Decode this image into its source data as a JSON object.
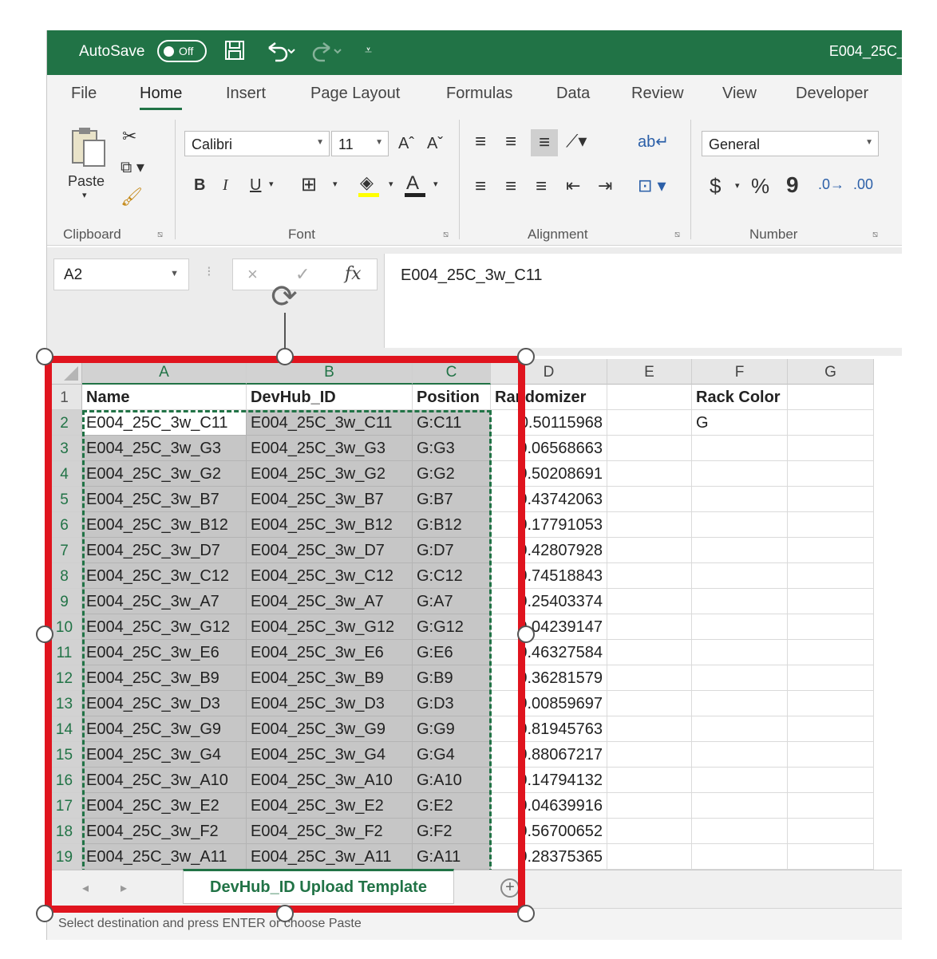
{
  "titlebar": {
    "autosave_label": "AutoSave",
    "autosave_state": "Off",
    "doc_title": "E004_25C_",
    "save_icon": "floppy-disk-icon",
    "undo_icon": "undo-icon",
    "redo_icon": "redo-icon"
  },
  "tabs": [
    "File",
    "Home",
    "Insert",
    "Page Layout",
    "Formulas",
    "Data",
    "Review",
    "View",
    "Developer"
  ],
  "active_tab": "Home",
  "ribbon": {
    "clipboard": {
      "paste_label": "Paste",
      "group_label": "Clipboard"
    },
    "font": {
      "font_name": "Calibri",
      "font_size": "11",
      "group_label": "Font",
      "bold": "B",
      "italic": "I",
      "underline": "U"
    },
    "alignment": {
      "group_label": "Alignment"
    },
    "number": {
      "format": "General",
      "currency": "$",
      "percent": "%",
      "comma": "9",
      "group_label": "Number"
    }
  },
  "formula_bar": {
    "name_box": "A2",
    "cancel_icon": "×",
    "enter_icon": "✓",
    "fx_label": "fx",
    "formula": "E004_25C_3w_C11"
  },
  "columns": [
    "A",
    "B",
    "C",
    "D",
    "E",
    "F",
    "G"
  ],
  "rows": [
    {
      "n": "1",
      "a": "Name",
      "b": "DevHub_ID",
      "c": "Position",
      "d": "Randomizer",
      "f": "Rack Color"
    },
    {
      "n": "2",
      "a": "E004_25C_3w_C11",
      "b": "E004_25C_3w_C11",
      "c": "G:C11",
      "d": "0.50115968",
      "f": "G"
    },
    {
      "n": "3",
      "a": "E004_25C_3w_G3",
      "b": "E004_25C_3w_G3",
      "c": "G:G3",
      "d": "0.06568663",
      "f": ""
    },
    {
      "n": "4",
      "a": "E004_25C_3w_G2",
      "b": "E004_25C_3w_G2",
      "c": "G:G2",
      "d": "0.50208691",
      "f": ""
    },
    {
      "n": "5",
      "a": "E004_25C_3w_B7",
      "b": "E004_25C_3w_B7",
      "c": "G:B7",
      "d": "0.43742063",
      "f": ""
    },
    {
      "n": "6",
      "a": "E004_25C_3w_B12",
      "b": "E004_25C_3w_B12",
      "c": "G:B12",
      "d": "0.17791053",
      "f": ""
    },
    {
      "n": "7",
      "a": "E004_25C_3w_D7",
      "b": "E004_25C_3w_D7",
      "c": "G:D7",
      "d": "0.42807928",
      "f": ""
    },
    {
      "n": "8",
      "a": "E004_25C_3w_C12",
      "b": "E004_25C_3w_C12",
      "c": "G:C12",
      "d": "0.74518843",
      "f": ""
    },
    {
      "n": "9",
      "a": "E004_25C_3w_A7",
      "b": "E004_25C_3w_A7",
      "c": "G:A7",
      "d": "0.25403374",
      "f": ""
    },
    {
      "n": "10",
      "a": "E004_25C_3w_G12",
      "b": "E004_25C_3w_G12",
      "c": "G:G12",
      "d": "0.04239147",
      "f": ""
    },
    {
      "n": "11",
      "a": "E004_25C_3w_E6",
      "b": "E004_25C_3w_E6",
      "c": "G:E6",
      "d": "0.46327584",
      "f": ""
    },
    {
      "n": "12",
      "a": "E004_25C_3w_B9",
      "b": "E004_25C_3w_B9",
      "c": "G:B9",
      "d": "0.36281579",
      "f": ""
    },
    {
      "n": "13",
      "a": "E004_25C_3w_D3",
      "b": "E004_25C_3w_D3",
      "c": "G:D3",
      "d": "0.00859697",
      "f": ""
    },
    {
      "n": "14",
      "a": "E004_25C_3w_G9",
      "b": "E004_25C_3w_G9",
      "c": "G:G9",
      "d": "0.81945763",
      "f": ""
    },
    {
      "n": "15",
      "a": "E004_25C_3w_G4",
      "b": "E004_25C_3w_G4",
      "c": "G:G4",
      "d": "0.88067217",
      "f": ""
    },
    {
      "n": "16",
      "a": "E004_25C_3w_A10",
      "b": "E004_25C_3w_A10",
      "c": "G:A10",
      "d": "0.14794132",
      "f": ""
    },
    {
      "n": "17",
      "a": "E004_25C_3w_E2",
      "b": "E004_25C_3w_E2",
      "c": "G:E2",
      "d": "0.04639916",
      "f": ""
    },
    {
      "n": "18",
      "a": "E004_25C_3w_F2",
      "b": "E004_25C_3w_F2",
      "c": "G:F2",
      "d": "0.56700652",
      "f": ""
    },
    {
      "n": "19",
      "a": "E004_25C_3w_A11",
      "b": "E004_25C_3w_A11",
      "c": "G:A11",
      "d": "0.28375365",
      "f": ""
    }
  ],
  "sheet_tab": "DevHub_ID Upload Template",
  "status_text": "Select destination and press ENTER or choose Paste",
  "colors": {
    "excel_green": "#217346",
    "highlight_red": "#e0141e",
    "copy_highlight": "#c6c6c6"
  }
}
